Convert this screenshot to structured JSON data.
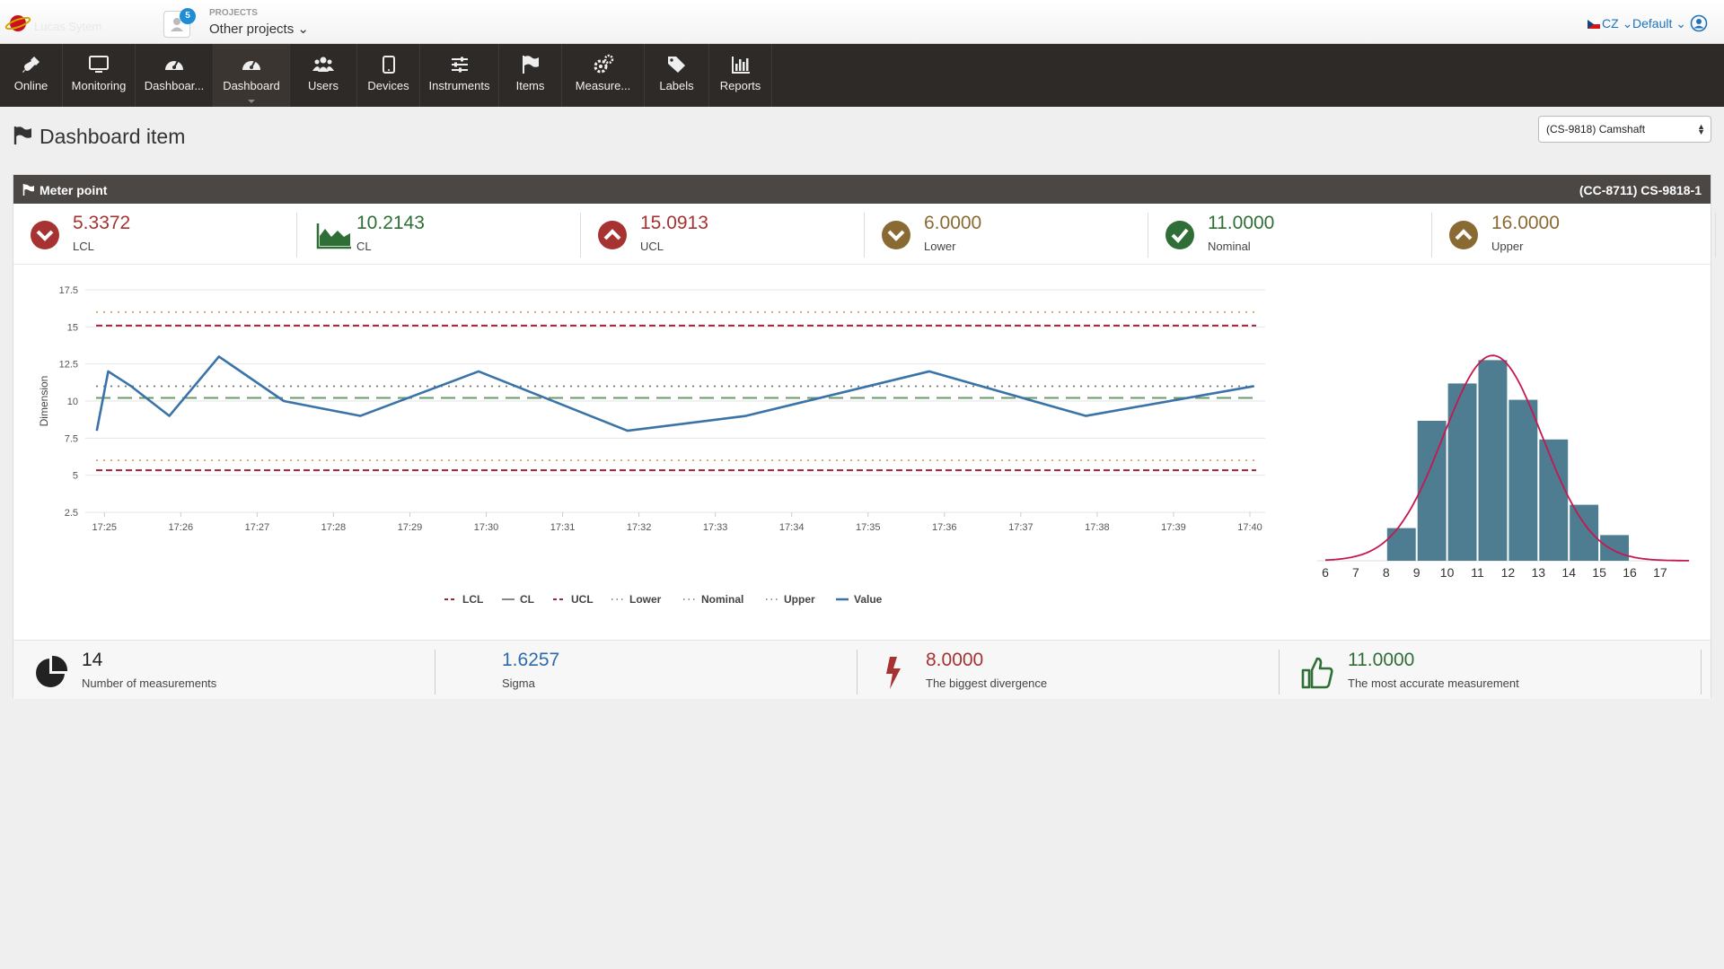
{
  "topbar": {
    "logo_text": "Lucas Sytem",
    "projects_label": "PROJECTS",
    "projects_value": "Other projects",
    "projects_badge": "5",
    "language": "CZ",
    "profile": "Default"
  },
  "nav": [
    {
      "label": "Online",
      "icon": "plug-icon"
    },
    {
      "label": "Monitoring",
      "icon": "monitor-icon"
    },
    {
      "label": "Dashboar...",
      "icon": "gauge-icon"
    },
    {
      "label": "Dashboard",
      "icon": "gauge-icon"
    },
    {
      "label": "Users",
      "icon": "users-icon"
    },
    {
      "label": "Devices",
      "icon": "tablet-icon"
    },
    {
      "label": "Instruments",
      "icon": "sliders-icon"
    },
    {
      "label": "Items",
      "icon": "flag-icon"
    },
    {
      "label": "Measure...",
      "icon": "gears-icon"
    },
    {
      "label": "Labels",
      "icon": "tags-icon"
    },
    {
      "label": "Reports",
      "icon": "bar-chart-icon"
    }
  ],
  "page": {
    "title": "Dashboard item",
    "select_value": "(CS-9818) Camshaft"
  },
  "panel": {
    "title": "Meter point",
    "id": "(CC-8711) CS-9818-1"
  },
  "stats": [
    {
      "value": "5.3372",
      "caption": "LCL",
      "color": "#a63232",
      "icon": "chevron-down-circle-icon"
    },
    {
      "value": "10.2143",
      "caption": "CL",
      "color": "#2f6e36",
      "icon": "area-chart-icon"
    },
    {
      "value": "15.0913",
      "caption": "UCL",
      "color": "#a63232",
      "icon": "chevron-up-circle-icon"
    },
    {
      "value": "6.0000",
      "caption": "Lower",
      "color": "#8a6a33",
      "icon": "chevron-down-circle-icon"
    },
    {
      "value": "11.0000",
      "caption": "Nominal",
      "color": "#2f6e36",
      "icon": "check-circle-icon"
    },
    {
      "value": "16.0000",
      "caption": "Upper",
      "color": "#8a6a33",
      "icon": "chevron-up-circle-icon"
    }
  ],
  "footer": [
    {
      "value": "14",
      "caption": "Number of measurements",
      "color": "#222222",
      "icon": "pie-chart-icon"
    },
    {
      "value": "1.6257",
      "caption": "Sigma",
      "color": "#2f6aa8",
      "icon": ""
    },
    {
      "value": "8.0000",
      "caption": "The biggest divergence",
      "color": "#a63232",
      "icon": "bolt-icon"
    },
    {
      "value": "11.0000",
      "caption": "The most accurate measurement",
      "color": "#2f6e36",
      "icon": "thumbs-up-icon"
    }
  ],
  "chart_data": [
    {
      "type": "line",
      "ylabel": "Dimension",
      "ylim": [
        2.5,
        17.5
      ],
      "y_ticks": [
        "2.5",
        "5",
        "7.5",
        "10",
        "12.5",
        "15",
        "17.5"
      ],
      "x_ticks": [
        "17:25",
        "17:26",
        "17:27",
        "17:28",
        "17:29",
        "17:30",
        "17:31",
        "17:32",
        "17:33",
        "17:34",
        "17:35",
        "17:36",
        "17:37",
        "17:38",
        "17:39",
        "17:40"
      ],
      "xlim_minutes": [
        -0.25,
        15.2
      ],
      "reference_lines": [
        {
          "name": "LCL",
          "value": 5.3372,
          "color": "#a1233a",
          "style": "dashed"
        },
        {
          "name": "CL",
          "value": 10.2143,
          "color": "#6a9a6a",
          "style": "longdash"
        },
        {
          "name": "UCL",
          "value": 15.0913,
          "color": "#a1233a",
          "style": "dashed"
        },
        {
          "name": "Lower",
          "value": 6.0,
          "color": "#d2a56a",
          "style": "dotted"
        },
        {
          "name": "Nominal",
          "value": 11.0,
          "color": "#777777",
          "style": "dotted"
        },
        {
          "name": "Upper",
          "value": 16.0,
          "color": "#d2a56a",
          "style": "dotted"
        }
      ],
      "series": [
        {
          "name": "Value",
          "color": "#3a73a8",
          "x_minutes": [
            -0.1,
            0.05,
            0.35,
            0.85,
            1.5,
            2.35,
            3.35,
            4.9,
            6.85,
            8.4,
            10.8,
            12.85,
            15.05
          ],
          "values": [
            8.0,
            12.0,
            11.0,
            9.0,
            13.0,
            10.0,
            9.0,
            12.0,
            8.0,
            9.0,
            12.0,
            9.0,
            11.0
          ]
        }
      ],
      "legend": [
        "LCL",
        "CL",
        "UCL",
        "Lower",
        "Nominal",
        "Upper",
        "Value"
      ],
      "legend_position": "bottom",
      "grid": true
    },
    {
      "type": "bar",
      "categories": [
        "6",
        "7",
        "8",
        "9",
        "10",
        "11",
        "12",
        "13",
        "14",
        "15",
        "16",
        "17"
      ],
      "values": [
        0,
        0,
        1.4,
        6.0,
        7.6,
        8.6,
        6.9,
        5.2,
        2.4,
        1.1,
        0,
        0
      ],
      "bar_color": "#4e7d92",
      "curve_color": "#c4184f",
      "curve": {
        "mean": 11.0,
        "sigma": 1.6257,
        "peak": 8.8
      }
    }
  ]
}
